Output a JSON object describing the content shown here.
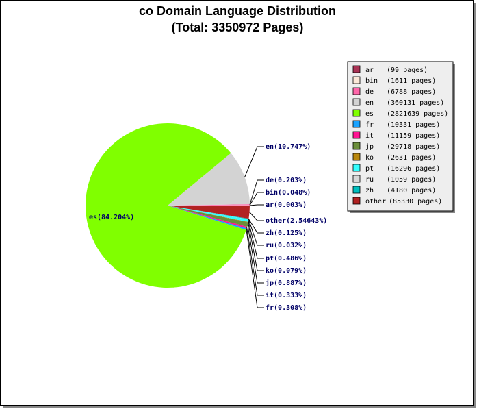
{
  "title_line1": "co Domain Language Distribution",
  "title_line2": "(Total: 3350972 Pages)",
  "chart_data": {
    "type": "pie",
    "title": "co Domain Language Distribution (Total: 3350972 Pages)",
    "total_pages": 3350972,
    "slices": [
      {
        "key": "ar",
        "pages": 99,
        "pct_label": "ar(0.003%)",
        "legend": "(99 pages)",
        "color": "#aa3355"
      },
      {
        "key": "bin",
        "pages": 1611,
        "pct_label": "bin(0.048%)",
        "legend": "(1611 pages)",
        "color": "#fce8d8"
      },
      {
        "key": "de",
        "pages": 6788,
        "pct_label": "de(0.203%)",
        "legend": "(6788 pages)",
        "color": "#ff66aa"
      },
      {
        "key": "en",
        "pages": 360131,
        "pct_label": "en(10.747%)",
        "legend": "(360131 pages)",
        "color": "#d3d3d3"
      },
      {
        "key": "es",
        "pages": 2821639,
        "pct_label": "es(84.204%)",
        "legend": "(2821639 pages)",
        "color": "#80ff00"
      },
      {
        "key": "fr",
        "pages": 10331,
        "pct_label": "fr(0.308%)",
        "legend": "(10331 pages)",
        "color": "#1aa3ff"
      },
      {
        "key": "it",
        "pages": 11159,
        "pct_label": "it(0.333%)",
        "legend": "(11159 pages)",
        "color": "#ff1493"
      },
      {
        "key": "jp",
        "pages": 29718,
        "pct_label": "jp(0.887%)",
        "legend": "(29718 pages)",
        "color": "#6b8e3a"
      },
      {
        "key": "ko",
        "pages": 2631,
        "pct_label": "ko(0.079%)",
        "legend": "(2631 pages)",
        "color": "#b8860b"
      },
      {
        "key": "pt",
        "pages": 16296,
        "pct_label": "pt(0.486%)",
        "legend": "(16296 pages)",
        "color": "#33ffff"
      },
      {
        "key": "ru",
        "pages": 1059,
        "pct_label": "ru(0.032%)",
        "legend": "(1059 pages)",
        "color": "#d8d8d8"
      },
      {
        "key": "zh",
        "pages": 4180,
        "pct_label": "zh(0.125%)",
        "legend": "(4180 pages)",
        "color": "#00bfbf"
      },
      {
        "key": "other",
        "pages": 85330,
        "pct_label": "other(2.54643%)",
        "legend": "(85330 pages)",
        "color": "#b22222"
      }
    ],
    "legend_placement": "right",
    "grid": false
  }
}
